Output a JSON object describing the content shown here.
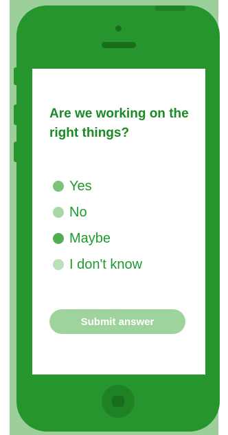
{
  "colors": {
    "phone_body": "#26952d",
    "backdrop": "#9ccf9a",
    "text_green": "#1a8a26",
    "submit_bg": "#9ed49c",
    "screen_bg": "#ffffff"
  },
  "survey": {
    "question": "Are we working on the right things?",
    "options": [
      {
        "label": "Yes",
        "radio_color": "#7cc27a"
      },
      {
        "label": "No",
        "radio_color": "#a8d7a6"
      },
      {
        "label": "Maybe",
        "radio_color": "#4fae52"
      },
      {
        "label": "I don't know",
        "radio_color": "#b9e0b7"
      }
    ],
    "submit_label": "Submit answer"
  },
  "device": {
    "icons": [
      "camera-icon",
      "speaker-icon",
      "home-button-icon"
    ]
  }
}
